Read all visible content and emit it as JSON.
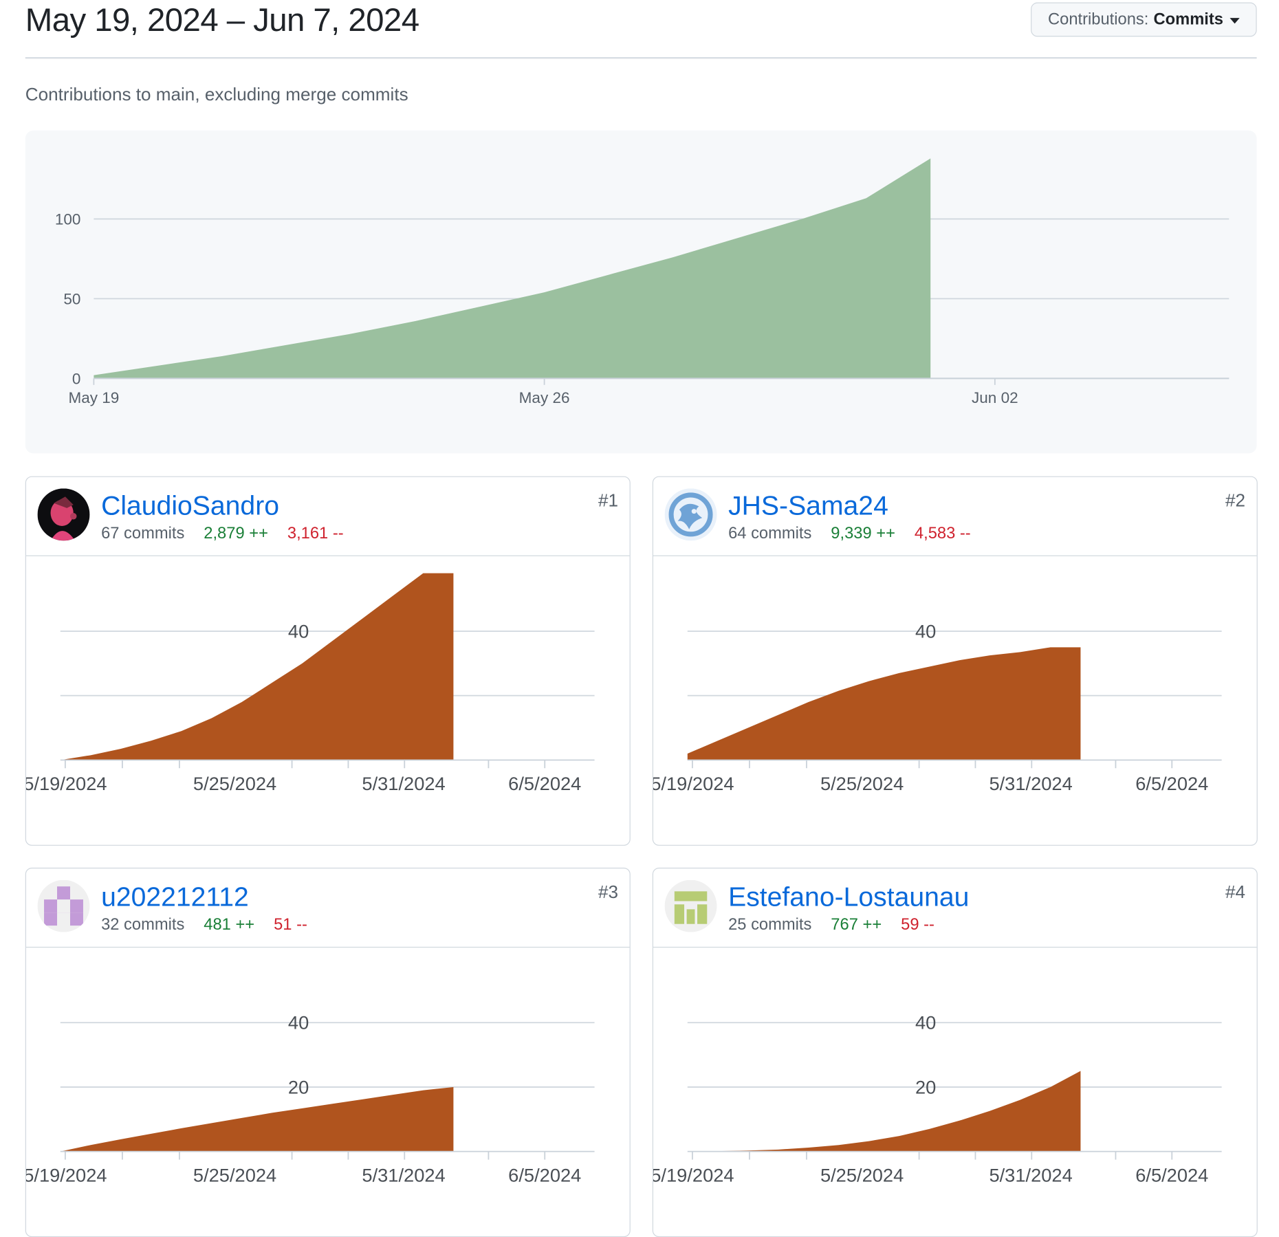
{
  "header": {
    "range": "May 19, 2024 – Jun 7, 2024"
  },
  "dropdown": {
    "label": "Contributions:",
    "value": "Commits"
  },
  "subtitle": "Contributions to main, excluding merge commits",
  "chart_data": [
    {
      "type": "area",
      "x": [
        "May 19",
        "May 20",
        "May 21",
        "May 22",
        "May 23",
        "May 24",
        "May 25",
        "May 26",
        "May 27",
        "May 28",
        "May 29",
        "May 30",
        "May 31",
        "Jun 01"
      ],
      "values": [
        2,
        8,
        14,
        21,
        28,
        36,
        45,
        54,
        65,
        76,
        88,
        100,
        113,
        138
      ],
      "x_ticks": [
        "May 19",
        "May 26",
        "Jun 02"
      ],
      "y_ticks": [
        0,
        50,
        100
      ],
      "ylim": [
        0,
        140
      ],
      "color": "#9bc09f"
    },
    {
      "type": "area",
      "x": [
        "5/19/2024",
        "5/20/2024",
        "5/21/2024",
        "5/22/2024",
        "5/23/2024",
        "5/24/2024",
        "5/25/2024",
        "5/26/2024",
        "5/27/2024",
        "5/28/2024",
        "5/29/2024",
        "5/30/2024",
        "5/31/2024",
        "6/1/2024"
      ],
      "values": [
        0,
        1.5,
        3.5,
        6,
        9,
        13,
        18,
        24,
        30,
        37,
        44,
        51,
        58,
        58
      ],
      "x_ticks": [
        "5/19/2024",
        "5/25/2024",
        "5/31/2024",
        "6/5/2024"
      ],
      "y_ticks": [
        40
      ],
      "ylim": [
        0,
        60
      ],
      "color": "#b0541e"
    },
    {
      "type": "area",
      "x": [
        "5/19/2024",
        "5/20/2024",
        "5/21/2024",
        "5/22/2024",
        "5/23/2024",
        "5/24/2024",
        "5/25/2024",
        "5/26/2024",
        "5/27/2024",
        "5/28/2024",
        "5/29/2024",
        "5/30/2024",
        "5/31/2024",
        "6/1/2024"
      ],
      "values": [
        2,
        6,
        10,
        14,
        18,
        21.5,
        24.5,
        27,
        29,
        31,
        32.5,
        33.5,
        35,
        35
      ],
      "x_ticks": [
        "5/19/2024",
        "5/25/2024",
        "5/31/2024",
        "6/5/2024"
      ],
      "y_ticks": [
        40
      ],
      "ylim": [
        0,
        60
      ],
      "color": "#b0541e"
    },
    {
      "type": "area",
      "x": [
        "5/19/2024",
        "5/20/2024",
        "5/21/2024",
        "5/22/2024",
        "5/23/2024",
        "5/24/2024",
        "5/25/2024",
        "5/26/2024",
        "5/27/2024",
        "5/28/2024",
        "5/29/2024",
        "5/30/2024",
        "5/31/2024",
        "6/1/2024"
      ],
      "values": [
        0,
        2,
        3.8,
        5.5,
        7.2,
        8.8,
        10.4,
        12,
        13.4,
        14.8,
        16.2,
        17.6,
        19,
        20
      ],
      "x_ticks": [
        "5/19/2024",
        "5/25/2024",
        "5/31/2024",
        "6/5/2024"
      ],
      "y_ticks": [
        20,
        40
      ],
      "ylim": [
        0,
        60
      ],
      "color": "#b0541e"
    },
    {
      "type": "area",
      "x": [
        "5/19/2024",
        "5/20/2024",
        "5/21/2024",
        "5/22/2024",
        "5/23/2024",
        "5/24/2024",
        "5/25/2024",
        "5/26/2024",
        "5/27/2024",
        "5/28/2024",
        "5/29/2024",
        "5/30/2024",
        "5/31/2024",
        "6/1/2024"
      ],
      "values": [
        0,
        0.1,
        0.3,
        0.6,
        1.2,
        2,
        3.2,
        4.8,
        7,
        9.6,
        12.6,
        16,
        20,
        25
      ],
      "x_ticks": [
        "5/19/2024",
        "5/25/2024",
        "5/31/2024",
        "6/5/2024"
      ],
      "y_ticks": [
        20,
        40
      ],
      "ylim": [
        0,
        60
      ],
      "color": "#b0541e"
    }
  ],
  "contributors": [
    {
      "name": "ClaudioSandro",
      "commits": "67 commits",
      "additions": "2,879 ++",
      "deletions": "3,161 --",
      "rank": "#1",
      "avatar_icon": "portrait-avatar-icon",
      "avatar_color": "#e0457b"
    },
    {
      "name": "JHS-Sama24",
      "commits": "64 commits",
      "additions": "9,339 ++",
      "deletions": "4,583 --",
      "rank": "#2",
      "avatar_icon": "dragon-avatar-icon",
      "avatar_color": "#6fa3d6"
    },
    {
      "name": "u202212112",
      "commits": "32 commits",
      "additions": "481 ++",
      "deletions": "51 --",
      "rank": "#3",
      "avatar_icon": "identicon-avatar-icon",
      "avatar_color": "#c39bd8"
    },
    {
      "name": "Estefano-Lostaunau",
      "commits": "25 commits",
      "additions": "767 ++",
      "deletions": "59 --",
      "rank": "#4",
      "avatar_icon": "identicon-avatar-icon",
      "avatar_color": "#b7cc74"
    }
  ]
}
